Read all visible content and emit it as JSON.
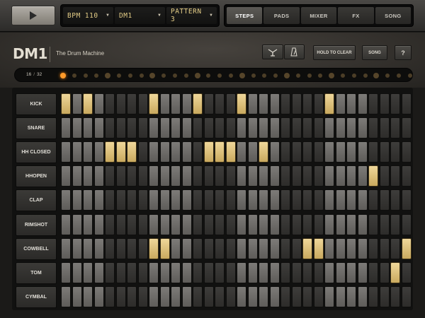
{
  "transport": {
    "play_label": ""
  },
  "displays": [
    {
      "text": "BPM 110"
    },
    {
      "text": "DM1"
    },
    {
      "text": "PATTERN 3"
    }
  ],
  "tabs": [
    {
      "label": "STEPS",
      "active": true
    },
    {
      "label": "PADS",
      "active": false
    },
    {
      "label": "MIXER",
      "active": false
    },
    {
      "label": "FX",
      "active": false
    },
    {
      "label": "SONG",
      "active": false
    }
  ],
  "header": {
    "logo": "DM1",
    "subtitle": "The Drum Machine",
    "hold_to_clear": "HOLD TO CLEAR",
    "song": "SONG",
    "help": "?",
    "tool_icons": [
      "eraser-tool-icon",
      "metronome-icon"
    ]
  },
  "indicator": {
    "current": "16",
    "separator": "/",
    "total": "32",
    "steps": 32,
    "active_step": 1
  },
  "tracks": [
    {
      "name": "KICK",
      "active_steps": [
        1,
        3,
        9,
        13,
        17,
        25
      ]
    },
    {
      "name": "SNARE",
      "active_steps": []
    },
    {
      "name": "HH CLOSED",
      "active_steps": [
        5,
        6,
        7,
        14,
        15,
        16,
        19
      ]
    },
    {
      "name": "HHOPEN",
      "active_steps": [
        29
      ]
    },
    {
      "name": "CLAP",
      "active_steps": []
    },
    {
      "name": "RIMSHOT",
      "active_steps": []
    },
    {
      "name": "COWBELL",
      "active_steps": [
        9,
        10,
        23,
        24,
        32
      ]
    },
    {
      "name": "TOM",
      "active_steps": [
        31
      ]
    },
    {
      "name": "CYMBAL",
      "active_steps": []
    }
  ],
  "colors": {
    "accent": "#ff9a2a",
    "step_on": "#e3c27a",
    "lcd_text": "#e3cc86"
  }
}
